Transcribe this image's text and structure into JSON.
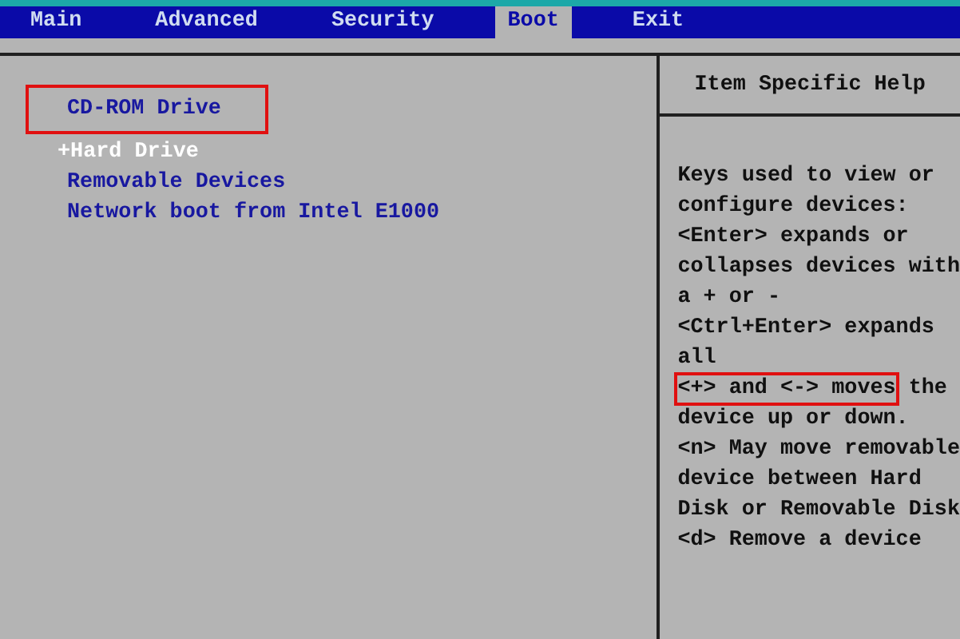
{
  "menu": [
    {
      "label": "Main",
      "selected": false
    },
    {
      "label": "Advanced",
      "selected": false
    },
    {
      "label": "Security",
      "selected": false
    },
    {
      "label": "Boot",
      "selected": true
    },
    {
      "label": "Exit",
      "selected": false
    }
  ],
  "boot_items": [
    {
      "kind": "device",
      "label": "CD-ROM Drive",
      "selected": false,
      "highlighted": true
    },
    {
      "kind": "group",
      "label": "+Hard Drive",
      "selected": true,
      "highlighted": false
    },
    {
      "kind": "device",
      "label": "Removable Devices",
      "selected": false,
      "highlighted": false
    },
    {
      "kind": "device",
      "label": "Network boot from Intel E1000",
      "selected": false,
      "highlighted": false
    }
  ],
  "help": {
    "title": "Item Specific Help",
    "lines": [
      {
        "segments": [
          {
            "text": "Keys used to view or",
            "highlighted": false
          }
        ]
      },
      {
        "segments": [
          {
            "text": "configure devices:",
            "highlighted": false
          }
        ]
      },
      {
        "segments": [
          {
            "text": "<Enter> expands or",
            "highlighted": false
          }
        ]
      },
      {
        "segments": [
          {
            "text": "collapses devices with",
            "highlighted": false
          }
        ]
      },
      {
        "segments": [
          {
            "text": "a + or -",
            "highlighted": false
          }
        ]
      },
      {
        "segments": [
          {
            "text": "<Ctrl+Enter> expands",
            "highlighted": false
          }
        ]
      },
      {
        "segments": [
          {
            "text": "all",
            "highlighted": false
          }
        ]
      },
      {
        "segments": [
          {
            "text": "<+> and <-> moves",
            "highlighted": true
          },
          {
            "text": "the",
            "highlighted": false
          }
        ]
      },
      {
        "segments": [
          {
            "text": "device up or down.",
            "highlighted": false
          }
        ]
      },
      {
        "segments": [
          {
            "text": "<n> May move removable",
            "highlighted": false
          }
        ]
      },
      {
        "segments": [
          {
            "text": "device between Hard",
            "highlighted": false
          }
        ]
      },
      {
        "segments": [
          {
            "text": "Disk or Removable Disk",
            "highlighted": false
          }
        ]
      },
      {
        "segments": [
          {
            "text": "<d> Remove a device",
            "highlighted": false
          }
        ]
      }
    ]
  }
}
